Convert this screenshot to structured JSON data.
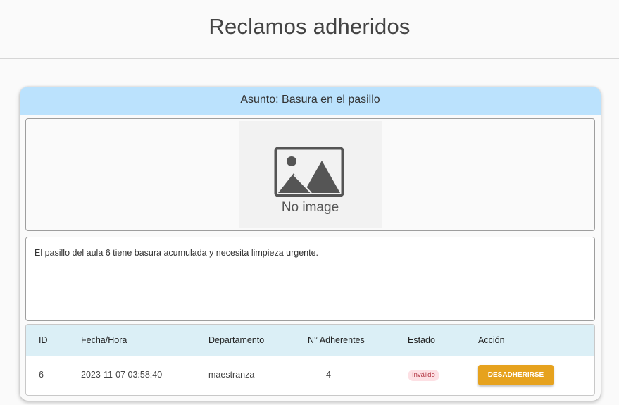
{
  "page": {
    "title": "Reclamos adheridos"
  },
  "claim": {
    "subject": "Asunto: Basura en el pasillo",
    "image_placeholder_text": "No image",
    "image_icon": "image-placeholder-icon",
    "description": "El pasillo del aula 6 tiene basura acumulada y necesita limpieza urgente."
  },
  "table": {
    "headers": {
      "id": "ID",
      "datetime": "Fecha/Hora",
      "department": "Departamento",
      "adherents": "N° Adherentes",
      "status": "Estado",
      "action": "Acción"
    },
    "row": {
      "id": "6",
      "datetime": "2023-11-07 03:58:40",
      "department": "maestranza",
      "adherents": "4",
      "status": "Inválido",
      "action": "DESADHERIRSE"
    }
  },
  "colors": {
    "header_bg": "#bbe2fd",
    "table_header_bg": "#dbeff6",
    "button_bg": "#e6a21e",
    "badge_bg": "#fde0e4",
    "badge_text": "#b0323f"
  }
}
